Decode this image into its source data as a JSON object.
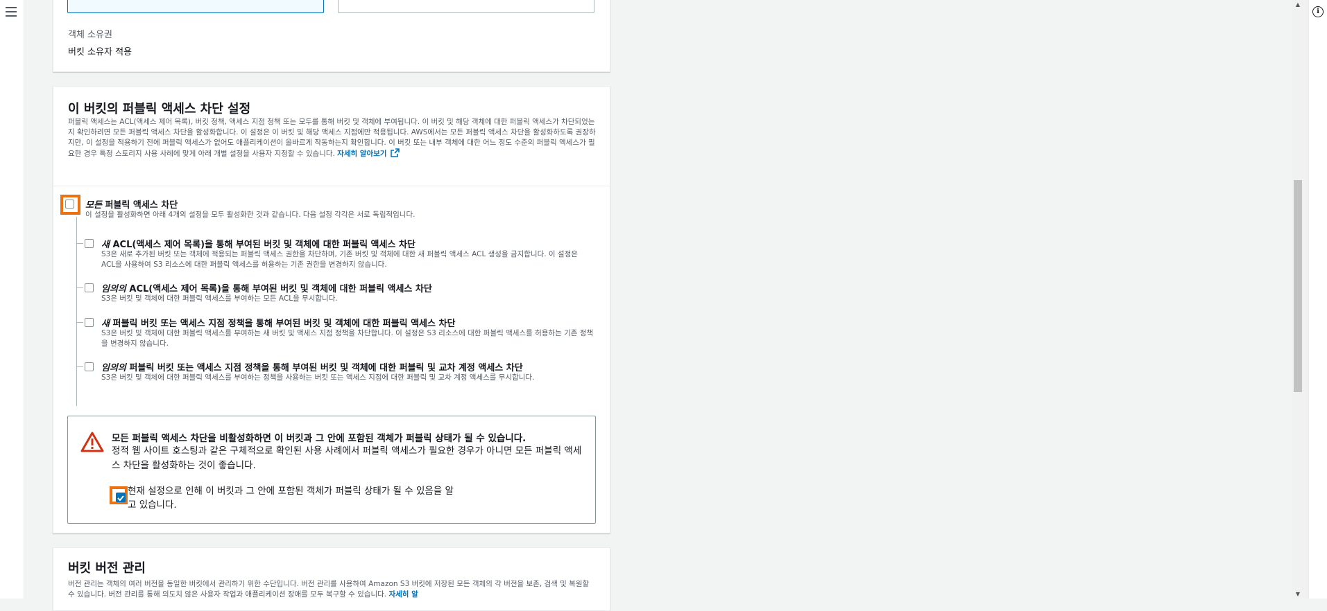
{
  "owner": {
    "label": "객체 소유권",
    "value": "버킷 소유자 적용"
  },
  "block": {
    "title": "이 버킷의 퍼블릭 액세스 차단 설정",
    "description": "퍼블릭 액세스는 ACL(액세스 제어 목록), 버킷 정책, 액세스 지점 정책 또는 모두를 통해 버킷 및 객체에 부여됩니다. 이 버킷 및 해당 객체에 대한 퍼블릭 액세스가 차단되었는지 확인하려면 모든 퍼블릭 액세스 차단을 활성화합니다. 이 설정은 이 버킷 및 해당 액세스 지점에만 적용됩니다. AWS에서는 모든 퍼블릭 액세스 차단을 활성화하도록 권장하지만, 이 설정을 적용하기 전에 퍼블릭 액세스가 없어도 애플리케이션이 올바르게 작동하는지 확인합니다. 이 버킷 또는 내부 객체에 대한 어느 정도 수준의 퍼블릭 액세스가 필요한 경우 특정 스토리지 사용 사례에 맞게 아래 개별 설정을 사용자 지정할 수 있습니다.",
    "learn_more": "자세히 알아보기",
    "block_all": {
      "title_italic": "모든",
      "title_rest": " 퍼블릭 액세스 차단",
      "desc": "이 설정을 활성화하면 아래 4개의 설정을 모두 활성화한 것과 같습니다. 다음 설정 각각은 서로 독립적입니다.",
      "checked": false
    },
    "options": [
      {
        "title_italic": "새",
        "title_rest": " ACL(액세스 제어 목록)을 통해 부여된 버킷 및 객체에 대한 퍼블릭 액세스 차단",
        "desc": "S3은 새로 추가된 버킷 또는 객체에 적용되는 퍼블릭 액세스 권한을 차단하며, 기존 버킷 및 객체에 대한 새 퍼블릭 액세스 ACL 생성을 금지합니다. 이 설정은 ACL을 사용하여 S3 리소스에 대한 퍼블릭 액세스를 허용하는 기존 권한을 변경하지 않습니다.",
        "checked": false
      },
      {
        "title_italic": "임의의",
        "title_rest": " ACL(액세스 제어 목록)을 통해 부여된 버킷 및 객체에 대한 퍼블릭 액세스 차단",
        "desc": "S3은 버킷 및 객체에 대한 퍼블릭 액세스를 부여하는 모든 ACL을 무시합니다.",
        "checked": false
      },
      {
        "title_italic": "새",
        "title_rest": " 퍼블릭 버킷 또는 액세스 지점 정책을 통해 부여된 버킷 및 객체에 대한 퍼블릭 액세스 차단",
        "desc": "S3은 버킷 및 객체에 대한 퍼블릭 액세스를 부여하는 새 버킷 및 액세스 지점 정책을 차단합니다. 이 설정은 S3 리소스에 대한 퍼블릭 액세스를 허용하는 기존 정책을 변경하지 않습니다.",
        "checked": false
      },
      {
        "title_italic": "임의의",
        "title_rest": " 퍼블릭 버킷 또는 액세스 지점 정책을 통해 부여된 버킷 및 객체에 대한 퍼블릭 및 교차 계정 액세스 차단",
        "desc": "S3은 버킷 및 객체에 대한 퍼블릭 액세스를 부여하는 정책을 사용하는 버킷 또는 액세스 지점에 대한 퍼블릭 및 교차 계정 액세스를 무시합니다.",
        "checked": false
      }
    ],
    "warning": {
      "title": "모든 퍼블릭 액세스 차단을 비활성화하면 이 버킷과 그 안에 포함된 객체가 퍼블릭 상태가 될 수 있습니다.",
      "text": "정적 웹 사이트 호스팅과 같은 구체적으로 확인된 사용 사례에서 퍼블릭 액세스가 필요한 경우가 아니면 모든 퍼블릭 액세스 차단을 활성화하는 것이 좋습니다.",
      "ack_label": "현재 설정으로 인해 이 버킷과 그 안에 포함된 객체가 퍼블릭 상태가 될 수 있음을 알고 있습니다.",
      "ack_checked": true
    }
  },
  "versioning": {
    "title": "버킷 버전 관리",
    "description": "버전 관리는 객체의 여러 버전을 동일한 버킷에서 관리하기 위한 수단입니다. 버전 관리를 사용하여 Amazon S3 버킷에 저장된 모든 객체의 각 버전을 보존, 검색 및 복원할 수 있습니다. 버전 관리를 통해 의도치 않은 사용자 작업과 애플리케이션 장애를 모두 복구할 수 있습니다.",
    "learn_more": "자세히 알"
  },
  "colors": {
    "accent": "#0073bb",
    "highlight": "#ec7211",
    "warning": "#d13212"
  },
  "icons": [
    "menu-icon",
    "info-icon",
    "external-link-icon",
    "warning-icon",
    "checkmark-icon"
  ]
}
